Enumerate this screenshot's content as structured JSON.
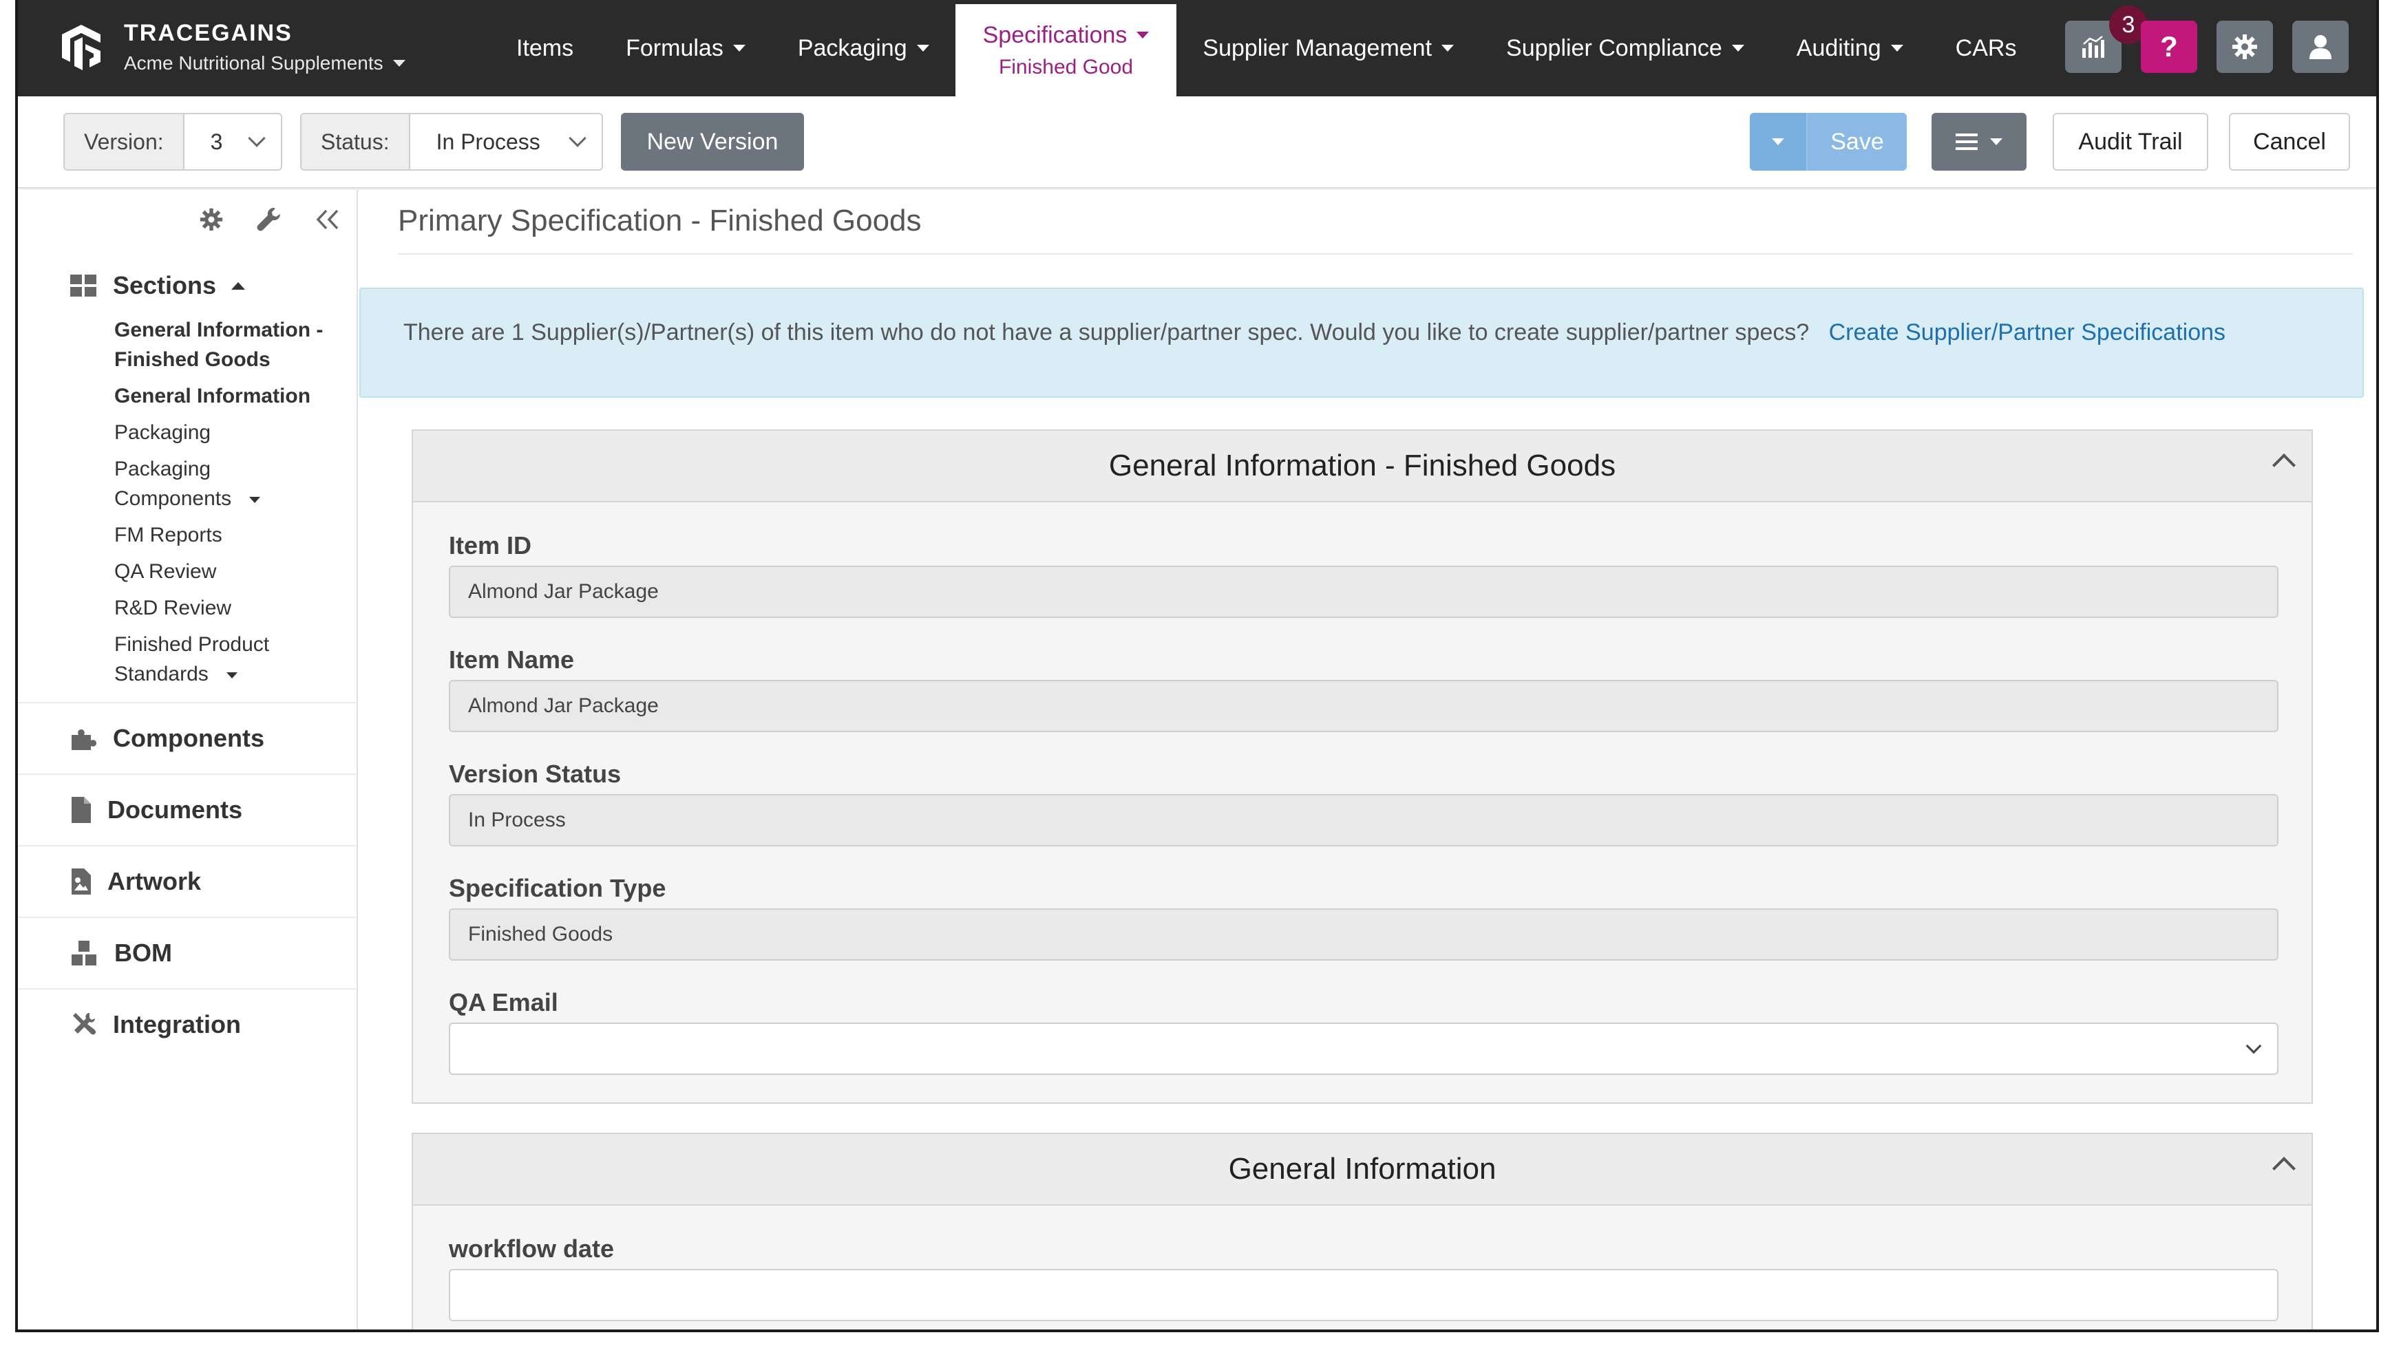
{
  "brand": {
    "name": "TRACEGAINS",
    "org": "Acme Nutritional Supplements"
  },
  "nav": {
    "items": [
      {
        "label": "Items",
        "dropdown": false
      },
      {
        "label": "Formulas",
        "dropdown": true
      },
      {
        "label": "Packaging",
        "dropdown": true
      },
      {
        "label": "Specifications",
        "dropdown": true,
        "active": true,
        "sub": "Finished Good"
      },
      {
        "label": "Supplier Management",
        "dropdown": true
      },
      {
        "label": "Supplier Compliance",
        "dropdown": true
      },
      {
        "label": "Auditing",
        "dropdown": true
      },
      {
        "label": "CARs",
        "dropdown": false
      }
    ],
    "badge_count": "3",
    "help_label": "?"
  },
  "toolbar": {
    "version_label": "Version:",
    "version_value": "3",
    "status_label": "Status:",
    "status_value": "In Process",
    "new_version": "New Version",
    "save": "Save",
    "audit_trail": "Audit Trail",
    "cancel": "Cancel"
  },
  "sidebar": {
    "sections_title": "Sections",
    "sections": [
      {
        "label": "General Information - Finished Goods",
        "bold": true,
        "dropdown": false
      },
      {
        "label": "General Information",
        "bold": true,
        "dropdown": false
      },
      {
        "label": "Packaging",
        "bold": false,
        "dropdown": false
      },
      {
        "label": "Packaging Components",
        "bold": false,
        "dropdown": true
      },
      {
        "label": "FM Reports",
        "bold": false,
        "dropdown": false
      },
      {
        "label": "QA Review",
        "bold": false,
        "dropdown": false
      },
      {
        "label": "R&D Review",
        "bold": false,
        "dropdown": false
      },
      {
        "label": "Finished Product Standards",
        "bold": false,
        "dropdown": true
      }
    ],
    "links": [
      "Components",
      "Documents",
      "Artwork",
      "BOM",
      "Integration"
    ]
  },
  "main": {
    "page_title": "Primary Specification - Finished Goods",
    "alert_text": "There are 1 Supplier(s)/Partner(s) of this item who do not have a supplier/partner spec. Would you like to create supplier/partner specs?",
    "alert_link": "Create Supplier/Partner Specifications",
    "panel1": {
      "title": "General Information - Finished Goods",
      "fields": [
        {
          "label": "Item ID",
          "value": "Almond Jar Package"
        },
        {
          "label": "Item Name",
          "value": "Almond Jar Package"
        },
        {
          "label": "Version Status",
          "value": "In Process"
        },
        {
          "label": "Specification Type",
          "value": "Finished Goods"
        },
        {
          "label": "QA Email",
          "value": ""
        }
      ]
    },
    "panel2": {
      "title": "General Information",
      "fields": [
        {
          "label": "workflow date",
          "value": ""
        }
      ]
    }
  }
}
